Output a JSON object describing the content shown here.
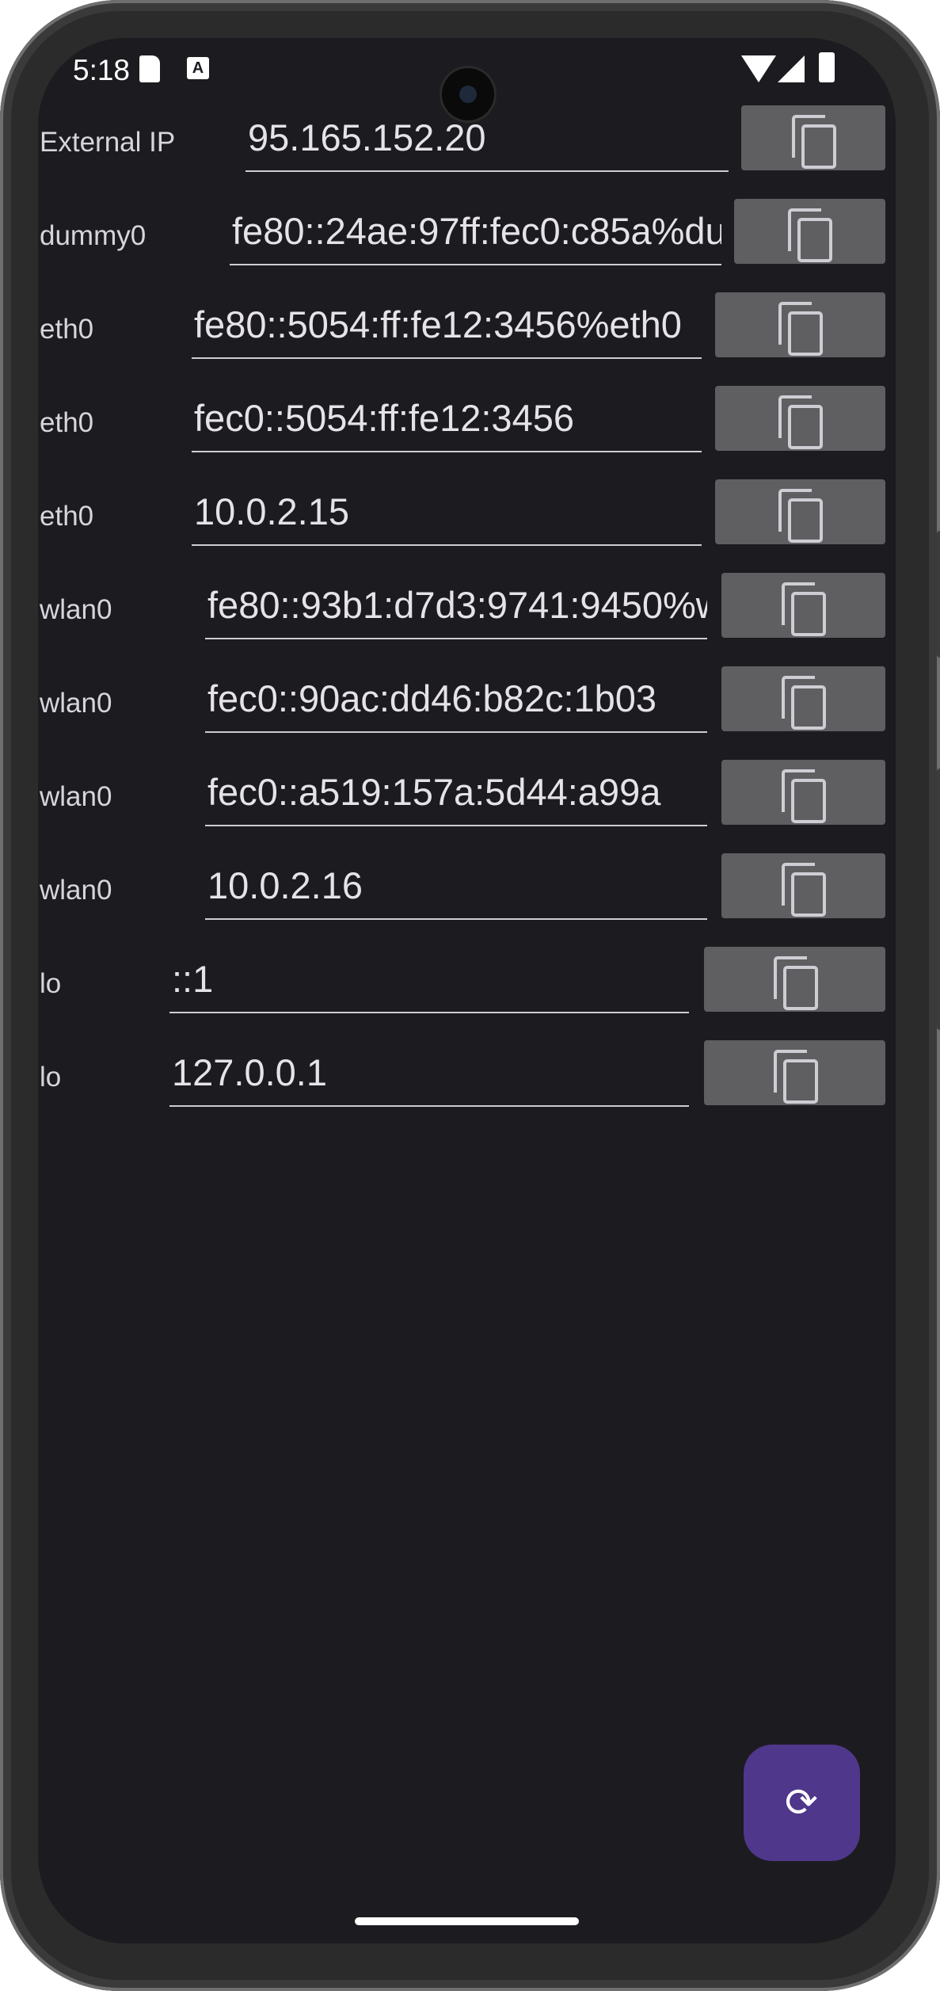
{
  "status_bar": {
    "time": "5:18"
  },
  "rows": [
    {
      "label": "External IP",
      "value": "95.165.152.20"
    },
    {
      "label": "dummy0",
      "value": "fe80::24ae:97ff:fec0:c85a%du"
    },
    {
      "label": "eth0",
      "value": "fe80::5054:ff:fe12:3456%eth0"
    },
    {
      "label": "eth0",
      "value": "fec0::5054:ff:fe12:3456"
    },
    {
      "label": "eth0",
      "value": "10.0.2.15"
    },
    {
      "label": "wlan0",
      "value": "fe80::93b1:d7d3:9741:9450%w"
    },
    {
      "label": "wlan0",
      "value": "fec0::90ac:dd46:b82c:1b03"
    },
    {
      "label": "wlan0",
      "value": "fec0::a519:157a:5d44:a99a"
    },
    {
      "label": "wlan0",
      "value": "10.0.2.16"
    },
    {
      "label": "lo",
      "value": "::1"
    },
    {
      "label": "lo",
      "value": "127.0.0.1"
    }
  ],
  "icons": {
    "copy": "copy-icon",
    "refresh": "refresh-icon"
  },
  "colors": {
    "background": "#1c1b1f",
    "copy_button": "#5f5f61",
    "fab": "#4f378b"
  }
}
